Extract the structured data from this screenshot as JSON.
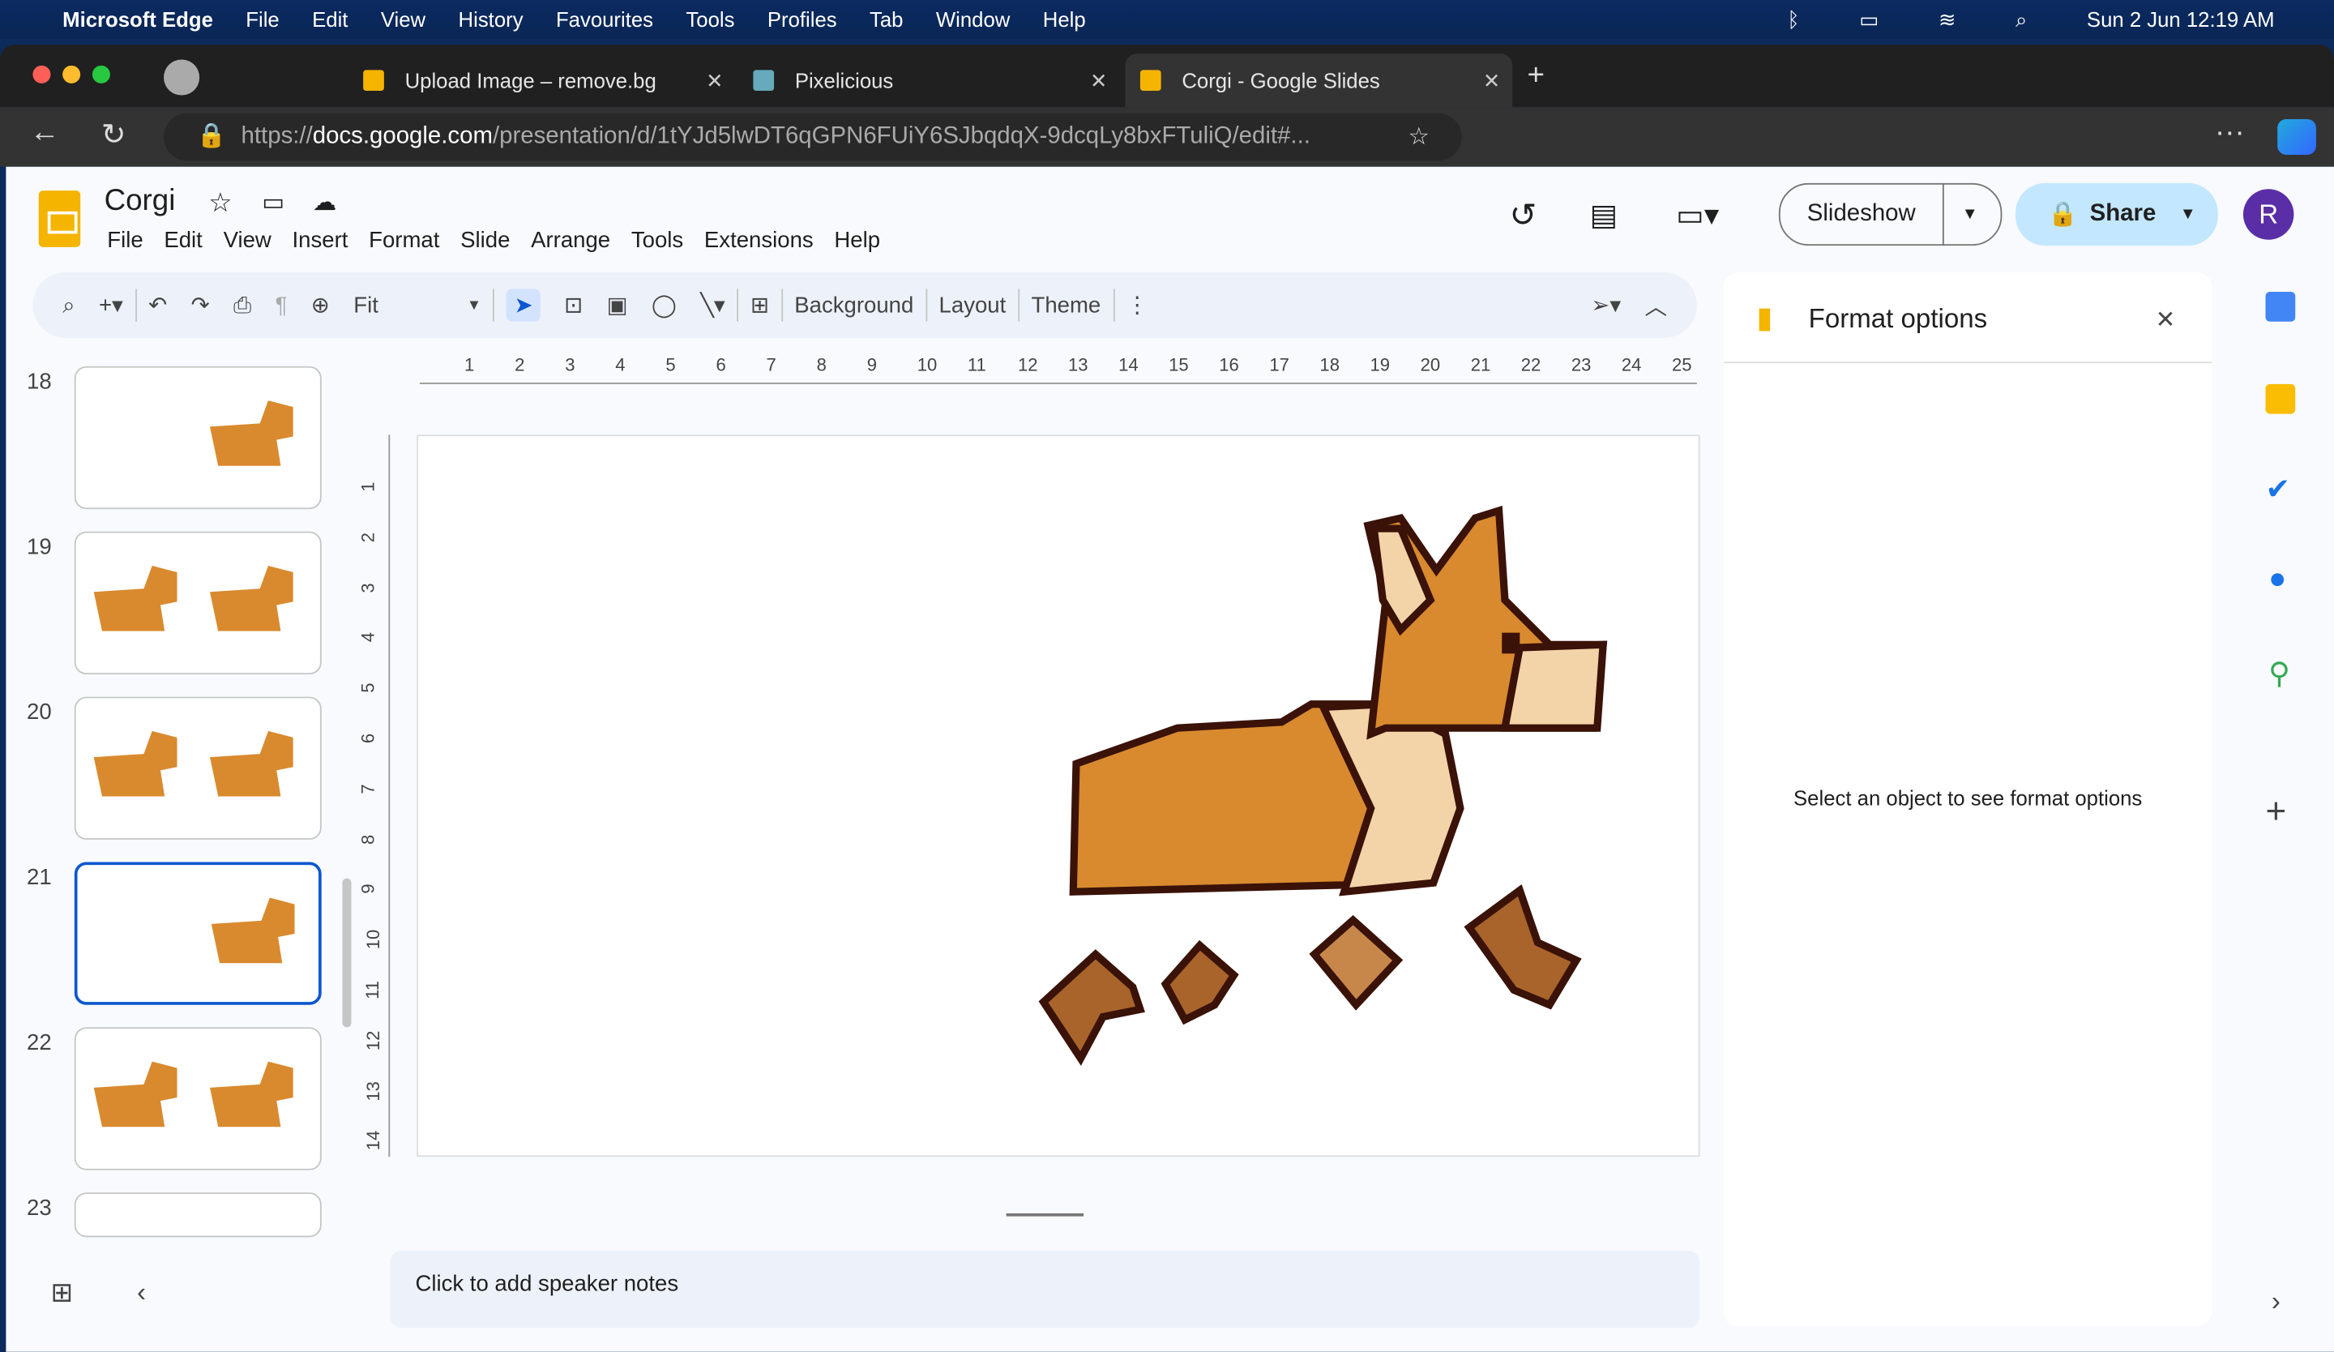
{
  "menubar": {
    "app": "Microsoft Edge",
    "items": [
      "File",
      "Edit",
      "View",
      "History",
      "Favourites",
      "Tools",
      "Profiles",
      "Tab",
      "Window",
      "Help"
    ],
    "clock": "Sun 2 Jun  12:19 AM"
  },
  "tabs": [
    {
      "title": "Upload Image – remove.bg"
    },
    {
      "title": "Pixelicious"
    },
    {
      "title": "Corgi - Google Slides",
      "active": true
    }
  ],
  "address": {
    "scheme": "https://",
    "host": "docs.google.com",
    "path": "/presentation/d/1tYJd5lwDT6qGPN6FUiY6SJbqdqX-9dcqLy8bxFTuliQ/edit#..."
  },
  "doc": {
    "title": "Corgi",
    "menus": [
      "File",
      "Edit",
      "View",
      "Insert",
      "Format",
      "Slide",
      "Arrange",
      "Tools",
      "Extensions",
      "Help"
    ],
    "slideshow": "Slideshow",
    "share": "Share",
    "avatar": "R"
  },
  "toolbar": {
    "zoom": "Fit",
    "background": "Background",
    "layout": "Layout",
    "theme": "Theme"
  },
  "ruler": {
    "h": [
      "1",
      "2",
      "3",
      "4",
      "5",
      "6",
      "7",
      "8",
      "9",
      "10",
      "11",
      "12",
      "13",
      "14",
      "15",
      "16",
      "17",
      "18",
      "19",
      "20",
      "21",
      "22",
      "23",
      "24",
      "25"
    ],
    "v": [
      "1",
      "2",
      "3",
      "4",
      "5",
      "6",
      "7",
      "8",
      "9",
      "10",
      "11",
      "12",
      "13",
      "14"
    ]
  },
  "slides": [
    {
      "n": "18"
    },
    {
      "n": "19"
    },
    {
      "n": "20"
    },
    {
      "n": "21",
      "selected": true
    },
    {
      "n": "22"
    },
    {
      "n": "23"
    }
  ],
  "format": {
    "title": "Format options",
    "empty": "Select an object to see format options"
  },
  "notes": {
    "placeholder": "Click to add speaker notes"
  },
  "colors": {
    "accent": "#0b57d0",
    "share_bg": "#c2e7ff",
    "corgi_orange": "#d98a2e",
    "corgi_cream": "#f3d3a8",
    "outline": "#3a1208"
  }
}
